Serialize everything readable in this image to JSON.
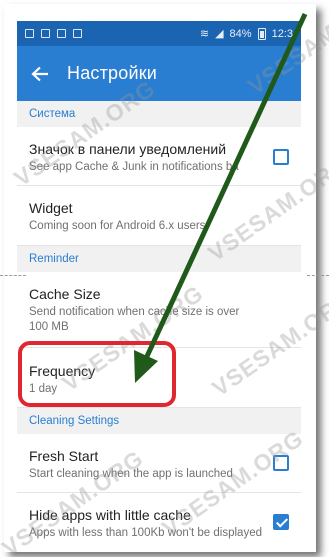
{
  "status_bar": {
    "battery": "84%",
    "time": "12:3"
  },
  "app_bar": {
    "title": "Настройки"
  },
  "sections": {
    "system": "Система",
    "reminder": "Reminder",
    "cleaning": "Cleaning Settings"
  },
  "items": {
    "notification_icon": {
      "title": "Значок в панели уведомлений",
      "subtitle": "See app Cache & Junk in notifications ba",
      "checked": false
    },
    "widget": {
      "title": "Widget",
      "subtitle": "Coming soon for Android 6.x users"
    },
    "cache_size": {
      "title": "Cache Size",
      "subtitle_line1": "Send notification when cache size is over",
      "subtitle_line2": "100 MB"
    },
    "frequency": {
      "title": "Frequency",
      "subtitle": "1 day"
    },
    "fresh_start": {
      "title": "Fresh Start",
      "subtitle": "Start cleaning when the app is launched",
      "checked": false
    },
    "hide_apps": {
      "title": "Hide apps with little cache",
      "subtitle": "Apps with less than 100Kb won't be displayed",
      "checked": true
    }
  },
  "watermark": "VSESAM.ORG",
  "colors": {
    "accent": "#2a7ed2",
    "status_bar": "#1b64b2",
    "highlight": "#e0262e",
    "arrow": "#1f5a1a"
  }
}
